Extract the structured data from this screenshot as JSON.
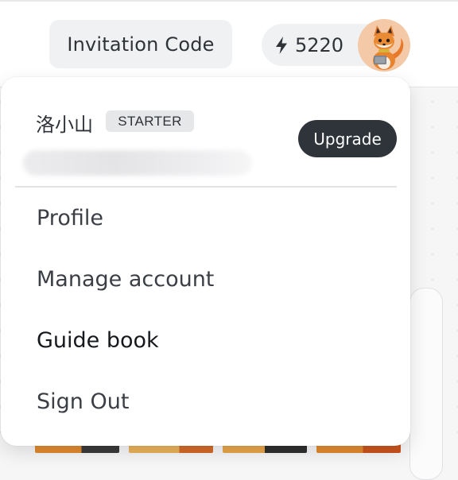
{
  "header": {
    "invitation_label": "Invitation Code",
    "credits": "5220",
    "credits_icon": "lightning-bolt-icon",
    "avatar": "fox-avatar"
  },
  "user_menu": {
    "user_name": "洛小山",
    "plan_badge": "STARTER",
    "upgrade_label": "Upgrade",
    "items": [
      {
        "label": "Profile"
      },
      {
        "label": "Manage account"
      },
      {
        "label": "Guide book"
      },
      {
        "label": "Sign Out"
      }
    ]
  },
  "colors": {
    "upgrade_bg": "#2f343b",
    "badge_bg": "#e6e7e9",
    "pill_bg": "#f0f1f3",
    "text": "#2f3338"
  }
}
